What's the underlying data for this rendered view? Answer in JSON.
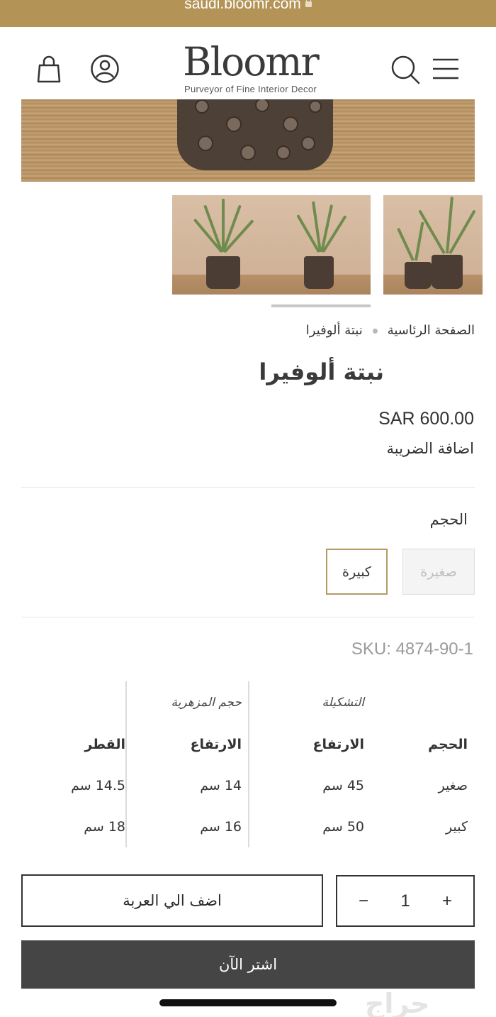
{
  "browser": {
    "url": "saudi.bloomr.com"
  },
  "header": {
    "logo_text": "Bloomr",
    "logo_tagline": "Purveyor of Fine Interior Decor"
  },
  "breadcrumb": {
    "home": "الصفحة الرئاسية",
    "current": "نبتة ألوفيرا"
  },
  "product": {
    "title": "نبتة ألوفيرا",
    "price": "SAR 600.00",
    "tax_note": "اضافة الضريبة",
    "size_label": "الحجم",
    "size_options": [
      {
        "label": "صغيرة",
        "state": "disabled"
      },
      {
        "label": "كبيرة",
        "state": "selected"
      }
    ],
    "sku": "SKU: 4874-90-1"
  },
  "spec_table": {
    "group_headers": {
      "arrangement": "التشكيلة",
      "vase": "حجم المزهرية"
    },
    "columns": [
      "الحجم",
      "الارتفاع",
      "الارتفاع",
      "القطر"
    ],
    "rows": [
      [
        "صغير",
        "45 سم",
        "14 سم",
        "14.5 سم"
      ],
      [
        "كبير",
        "50 سم",
        "16 سم",
        "18 سم"
      ]
    ]
  },
  "purchase": {
    "quantity": "1",
    "minus": "−",
    "plus": "+",
    "add_to_cart": "اضف الي العربة",
    "buy_now": "اشتر الآن"
  },
  "watermark": "حراج",
  "colors": {
    "brand_gold": "#b49356",
    "selected_border": "#b59a66",
    "buy_button": "#454545"
  }
}
